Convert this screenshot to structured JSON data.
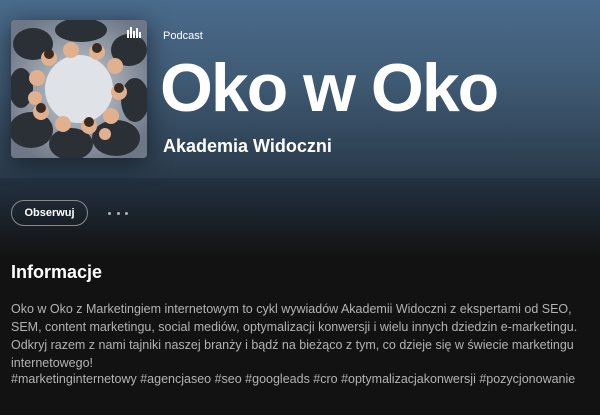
{
  "podcast": {
    "type_label": "Podcast",
    "title": "Oko w Oko",
    "author": "Akademia Widoczni"
  },
  "actions": {
    "follow_label": "Obserwuj",
    "more_icon": "more-horizontal-icon"
  },
  "info": {
    "heading": "Informacje",
    "description": "Oko w Oko z Marketingiem internetowym to cykl wywiadów Akademii Widoczni z ekspertami od SEO, SEM, content marketingu, social mediów, optymalizacji konwersji i wielu innych dziedzin e-marketingu. Odkryj razem z nami tajniki naszej branży i bądź na bieżąco z tym, co dzieje się w świecie marketingu internetowego!",
    "tags": "#marketinginternetowy #agencjaseo #seo #googleads #cro #optymalizacjakonwersji #pozycjonowanie"
  },
  "colors": {
    "hero_top": "#4a6b8c",
    "background": "#121212",
    "muted_text": "#b3b3b3"
  }
}
